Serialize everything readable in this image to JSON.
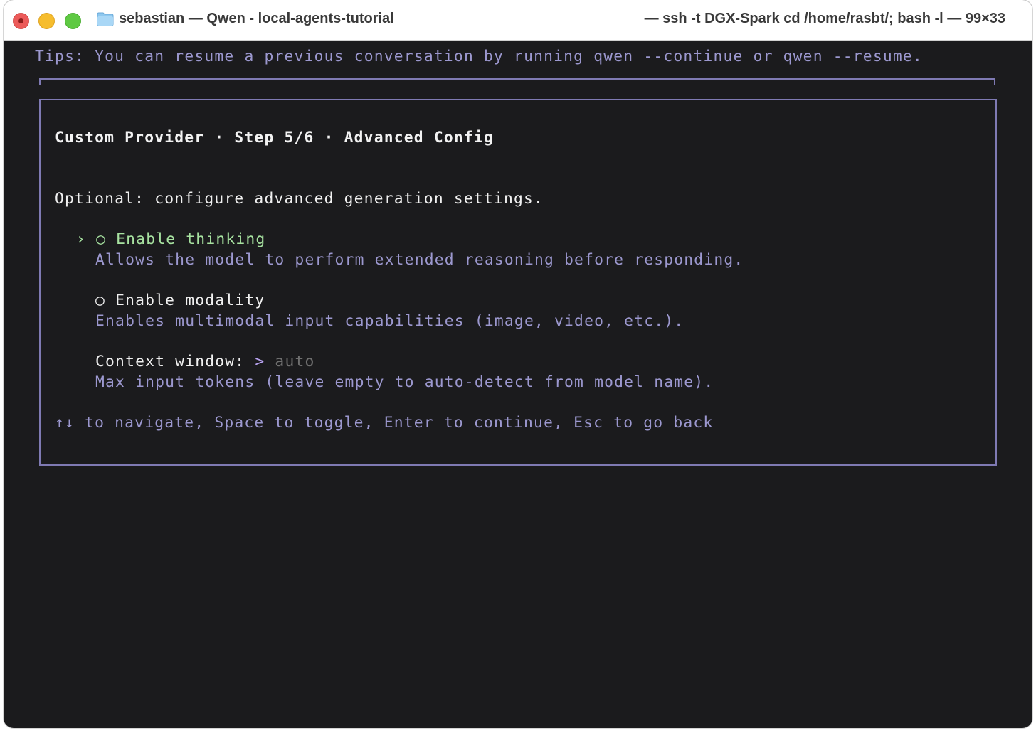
{
  "window": {
    "title_left": "sebastian — Qwen - local-agents-tutorial",
    "title_right": "— ssh -t DGX-Spark cd /home/rasbt/; bash -l — 99×33",
    "folder_icon": "folder-icon"
  },
  "terminal": {
    "tips": "Tips: You can resume a previous conversation by running qwen --continue or qwen --resume.",
    "panel": {
      "heading": "Custom Provider · Step 5/6 · Advanced Config",
      "intro": "Optional: configure advanced generation settings.",
      "options": [
        {
          "cursor": "›",
          "radio": "○",
          "label": "Enable thinking",
          "description": "Allows the model to perform extended reasoning before responding."
        },
        {
          "radio": "○",
          "label": "Enable modality",
          "description": "Enables multimodal input capabilities (image, video, etc.)."
        }
      ],
      "context_window": {
        "label": "Context window: ",
        "prompt": ">",
        "value": "auto",
        "description": "Max input tokens (leave empty to auto-detect from model name)."
      },
      "help": "↑↓ to navigate, Space to toggle, Enter to continue, Esc to go back"
    }
  },
  "colors": {
    "background": "#1b1b1d",
    "accent_border": "#7f7ab3",
    "muted_text": "#9c98cf",
    "selected_option": "#a7e2a0",
    "prompt": "#b9a3f2"
  }
}
